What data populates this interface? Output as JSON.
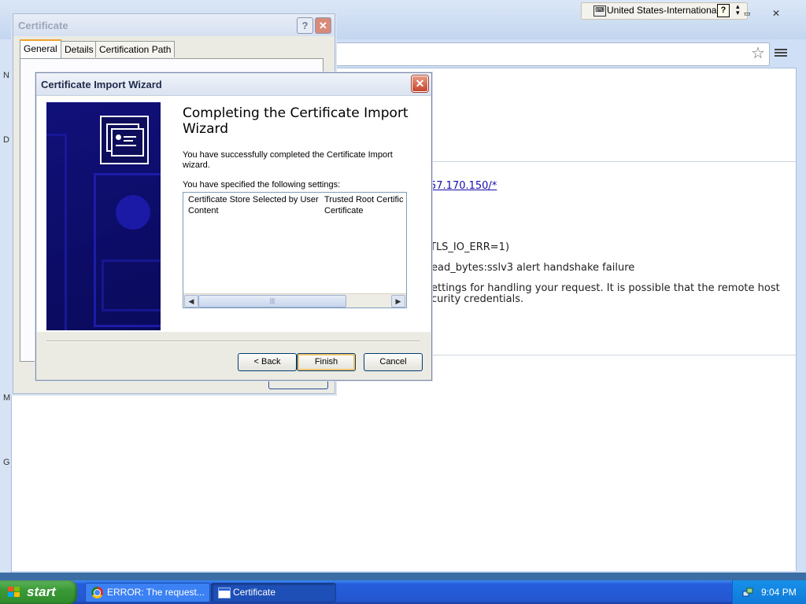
{
  "langbar": {
    "language": "United States-International",
    "help": "?",
    "options": "▲▼"
  },
  "browser": {
    "edge_letters": [
      "N",
      "D",
      "M",
      "G"
    ],
    "error_lines": {
      "url": "57.170.150/*",
      "code": "TLS_IO_ERR=1)",
      "detail": "ead_bytes:sslv3 alert handshake failure",
      "msg1": "ettings for handling your request. It is possible that the remote host",
      "msg2": "curity credentials."
    }
  },
  "cert_window": {
    "title": "Certificate",
    "help_btn": "?",
    "close_btn": "✕",
    "tabs": [
      "General",
      "Details",
      "Certification Path"
    ]
  },
  "wizard": {
    "title": "Certificate Import Wizard",
    "close_btn": "✕",
    "heading": "Completing the Certificate Import Wizard",
    "success_text": "You have successfully completed the Certificate Import wizard.",
    "settings_label": "You have specified the following settings:",
    "settings": [
      {
        "name": "Certificate Store Selected by User",
        "value": "Trusted Root Certification Authorities"
      },
      {
        "name": "Content",
        "value": "Certificate"
      }
    ],
    "buttons": {
      "back": "< Back",
      "finish": "Finish",
      "cancel": "Cancel"
    }
  },
  "taskbar": {
    "start": "start",
    "tasks": [
      {
        "label": "ERROR: The request...",
        "icon": "chrome-icon",
        "active": false
      },
      {
        "label": "Certificate",
        "icon": "certificate-icon",
        "active": true
      }
    ],
    "clock": "9:04 PM"
  }
}
